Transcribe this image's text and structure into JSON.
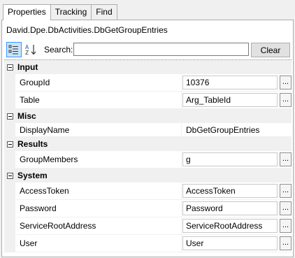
{
  "tabs": [
    {
      "label": "Properties",
      "active": true
    },
    {
      "label": "Tracking",
      "active": false
    },
    {
      "label": "Find",
      "active": false
    }
  ],
  "class_title": "David.Dpe.DbActivities.DbGetGroupEntries",
  "toolbar": {
    "categorized_icon": "categorized-icon",
    "alphabetical_icon": "sort-az-icon",
    "search_label": "Search:",
    "search_value": "",
    "clear_label": "Clear"
  },
  "categories": [
    {
      "name": "Input",
      "properties": [
        {
          "name": "GroupId",
          "value": "10376",
          "has_button": true
        },
        {
          "name": "Table",
          "value": "Arg_TableId",
          "has_button": true
        }
      ]
    },
    {
      "name": "Misc",
      "properties": [
        {
          "name": "DisplayName",
          "value": "DbGetGroupEntries",
          "has_button": false
        }
      ]
    },
    {
      "name": "Results",
      "properties": [
        {
          "name": "GroupMembers",
          "value": "g",
          "has_button": true
        }
      ]
    },
    {
      "name": "System",
      "properties": [
        {
          "name": "AccessToken",
          "value": "AccessToken",
          "has_button": true
        },
        {
          "name": "Password",
          "value": "Password",
          "has_button": true
        },
        {
          "name": "ServiceRootAddress",
          "value": "ServiceRootAddress",
          "has_button": true
        },
        {
          "name": "User",
          "value": "User",
          "has_button": true
        }
      ]
    }
  ],
  "ellipsis_label": "..."
}
